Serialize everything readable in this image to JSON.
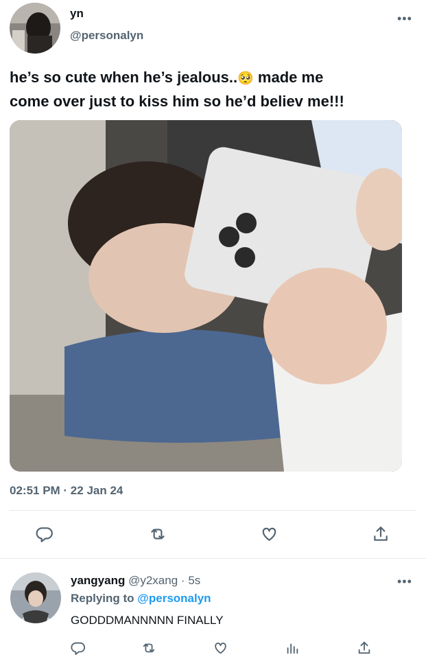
{
  "tweet": {
    "display_name": "yn",
    "handle": "@personalyn",
    "text_line1": "he’s so cute when he’s jealous..",
    "emoji": "🥺",
    "text_line1_end": " made me",
    "text_line2": "come over just to kiss him so he’d believ me!!!",
    "timestamp": "02:51 PM · 22 Jan 24",
    "icons": [
      "reply-icon",
      "retweet-icon",
      "like-icon",
      "share-icon"
    ]
  },
  "reply": {
    "display_name": "yangyang",
    "handle": "@y2xang",
    "dot": "·",
    "time": "5s",
    "replying_prefix": "Replying to",
    "replying_handle": "@personalyn",
    "text": "GODDDMANNNNN FINALLY",
    "icons": [
      "reply-icon",
      "retweet-icon",
      "like-icon",
      "analytics-icon",
      "share-icon"
    ]
  },
  "more_glyph": "•••",
  "colors": {
    "link": "#1d9bf0",
    "secondary": "#536471",
    "divider": "#e6e9eb"
  }
}
